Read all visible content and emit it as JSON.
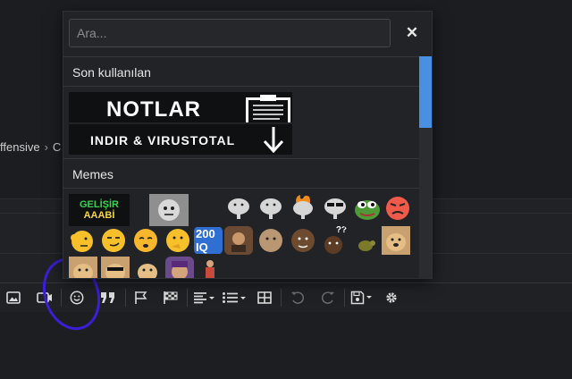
{
  "background": {
    "breadcrumb": {
      "left": "ffensive",
      "sep": "›",
      "right": "C"
    }
  },
  "popup": {
    "search": {
      "placeholder": "Ara..."
    },
    "close_glyph": "✕",
    "sections": [
      {
        "title": "Son kullanılan",
        "banners": [
          {
            "text": "NOTLAR",
            "icon": "clipboard-icon"
          },
          {
            "text": "INDIR & VIRUSTOTAL",
            "icon": "down-arrow-icon"
          }
        ]
      },
      {
        "title": "Memes",
        "gelisir_label": "GELİŞİR",
        "aaabi_label": "AAABİ",
        "iq_label": "200 IQ",
        "qq_label": "??"
      }
    ]
  },
  "toolbar": {
    "buttons": [
      {
        "name": "insert-image-button",
        "icon": "image-icon"
      },
      {
        "name": "insert-media-button",
        "icon": "media-icon"
      },
      {
        "name": "smilies-button",
        "icon": "smiley-icon"
      },
      {
        "name": "quote-button",
        "icon": "quote-icon"
      },
      {
        "name": "spoiler-button",
        "icon": "flag-icon"
      },
      {
        "name": "inline-spoiler-button",
        "icon": "checkered-flag-icon"
      },
      {
        "name": "align-button",
        "icon": "align-left-icon"
      },
      {
        "name": "list-button",
        "icon": "list-icon"
      },
      {
        "name": "table-button",
        "icon": "table-icon"
      },
      {
        "name": "undo-button",
        "icon": "undo-icon"
      },
      {
        "name": "redo-button",
        "icon": "redo-icon"
      },
      {
        "name": "drafts-button",
        "icon": "floppy-icon"
      },
      {
        "name": "toggle-bbcode-button",
        "icon": "gear-icon"
      }
    ]
  },
  "colors": {
    "accent": "#4a90e2",
    "annotation": "#3b1fd6",
    "popup_bg": "#212327",
    "page_bg": "#1c1e22"
  }
}
